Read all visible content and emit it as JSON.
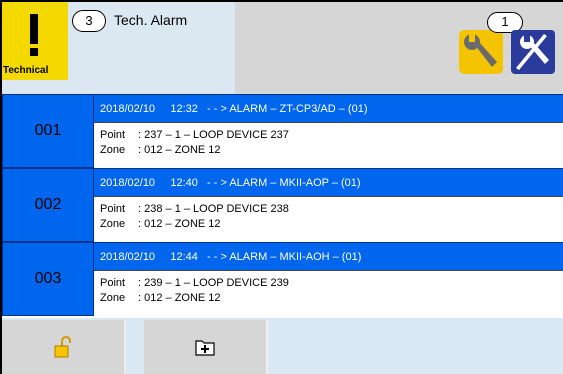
{
  "header": {
    "alarm_count": "3",
    "alarm_title": "Tech. Alarm",
    "technical_label": "Technical",
    "tool_badge": "1"
  },
  "alarms": [
    {
      "number": "001",
      "headline": "2018/02/10     12:32   - - > ALARM – ZT-CP3/AD – (01)",
      "point_label": "Point",
      "point_value": ": 237 – 1 – LOOP DEVICE 237",
      "zone_label": "Zone",
      "zone_value": ": 012 – ZONE 12"
    },
    {
      "number": "002",
      "headline": "2018/02/10     12:40   - - > ALARM – MKII-AOP – (01)",
      "point_label": "Point",
      "point_value": ": 238 – 1 – LOOP DEVICE 238",
      "zone_label": "Zone",
      "zone_value": ": 012 – ZONE 12"
    },
    {
      "number": "003",
      "headline": "2018/02/10     12:44   - - > ALARM – MKII-AOH – (01)",
      "point_label": "Point",
      "point_value": ": 239 – 1 – LOOP DEVICE 239",
      "zone_label": "Zone",
      "zone_value": ": 012 – ZONE 12"
    }
  ],
  "icons": {
    "technical": "warning-icon",
    "tools": "wrench-icon",
    "disable": "disable-tool-icon",
    "unlock": "unlock-icon",
    "add_folder": "add-folder-icon"
  },
  "colors": {
    "accent_blue": "#0066ee",
    "warning_yellow": "#f4d900",
    "panel_blue": "#dbe8f1",
    "header_gray": "#d6d6d6"
  }
}
